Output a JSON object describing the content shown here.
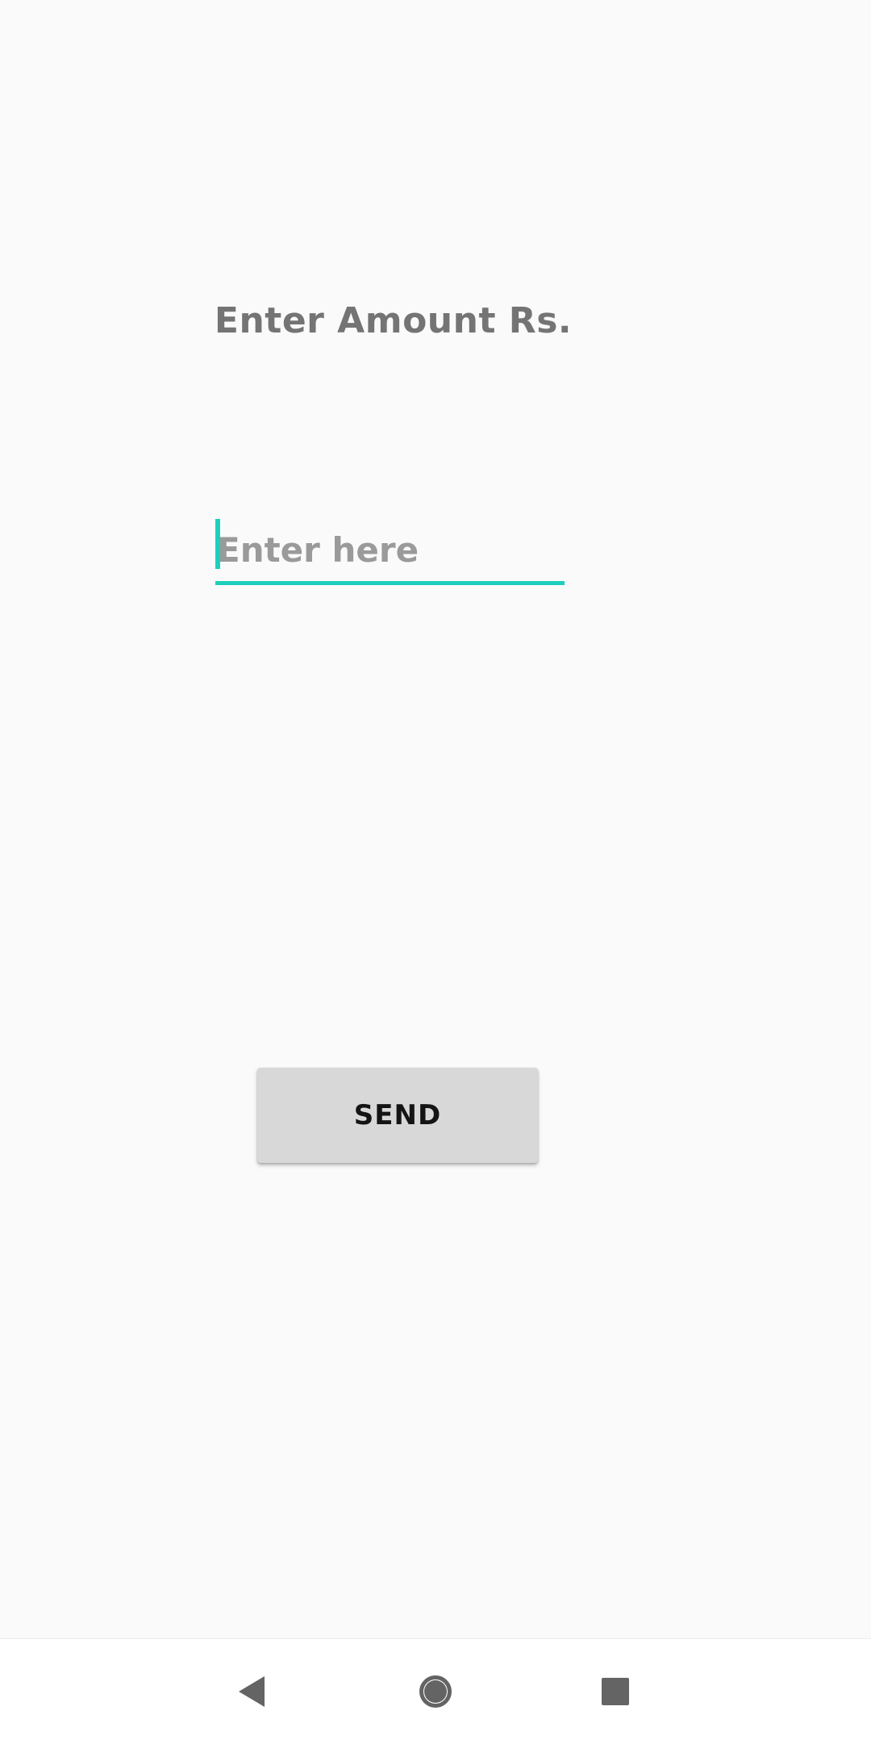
{
  "screen": {
    "title": "Enter Amount Rs.",
    "amount_input": {
      "value": "",
      "placeholder": "Enter here"
    },
    "send_label": "SEND"
  },
  "navigation_bar": {
    "back_icon": "back-triangle-icon",
    "home_icon": "home-circle-icon",
    "recents_icon": "recents-square-icon"
  },
  "colors": {
    "background": "#fafafa",
    "accent": "#1ecfbd",
    "title_text": "#747474",
    "placeholder_text": "#9a9a9a",
    "button_background": "#d8d8d8",
    "button_text": "#141414",
    "nav_icon": "#646464"
  }
}
